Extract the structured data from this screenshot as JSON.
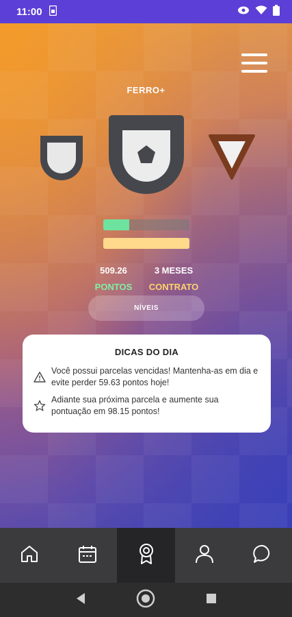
{
  "status": {
    "time": "11:00"
  },
  "level": {
    "title": "FERRO+"
  },
  "progress": {
    "points_fraction": 0.3,
    "contract_fraction": 1.0
  },
  "stats": {
    "points_value": "509.26",
    "points_label": "PONTOS",
    "contract_value": "3 MESES",
    "contract_label": "CONTRATO"
  },
  "levels_button": "NÍVEIS",
  "tips": {
    "title": "DICAS DO DIA",
    "items": [
      {
        "icon": "warning-icon",
        "text": "Você possui parcelas vencidas! Mantenha-as em dia e evite perder 59.63 pontos hoje!"
      },
      {
        "icon": "star-icon",
        "text": "Adiante sua próxima parcela e aumente sua pontuação em 98.15 pontos!"
      }
    ]
  },
  "nav": [
    {
      "icon": "home-icon",
      "active": false
    },
    {
      "icon": "calendar-icon",
      "active": false
    },
    {
      "icon": "award-icon",
      "active": true
    },
    {
      "icon": "user-icon",
      "active": false
    },
    {
      "icon": "chat-icon",
      "active": false
    }
  ],
  "colors": {
    "status_bar": "#5b3fd6",
    "points": "#7ff0a4",
    "contract": "#ffd36b",
    "nav_bg": "#3b3b3e"
  }
}
